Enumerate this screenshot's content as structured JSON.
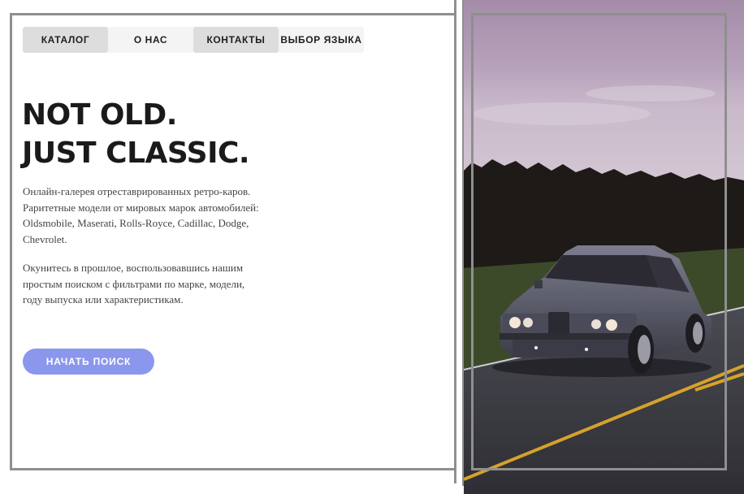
{
  "nav": {
    "items": [
      {
        "label": "КАТАЛОГ"
      },
      {
        "label": "О НАС"
      },
      {
        "label": "КОНТАКТЫ"
      },
      {
        "label": "ВЫБОР ЯЗЫКА"
      }
    ]
  },
  "hero": {
    "title_line1": "NOT OLD.",
    "title_line2": "JUST CLASSIC.",
    "paragraph1": "Онлайн-галерея отреставрированных ретро-каров. Раритетные модели от мировых марок автомобилей: Oldsmobile, Maserati, Rolls-Royce, Cadillac, Dodge, Chevrolet.",
    "paragraph2": "Окунитесь в прошлое, воспользовавшись нашим простым поиском с фильтрами по марке, модели, году выпуска или характеристикам.",
    "cta_label": "НАЧАТЬ ПОИСК"
  },
  "colors": {
    "accent": "#8b97ec",
    "frame": "#8f8f8f",
    "text": "#1a1a1a",
    "nav_active_bg": "#dddddd",
    "nav_bg": "#f4f4f4"
  }
}
